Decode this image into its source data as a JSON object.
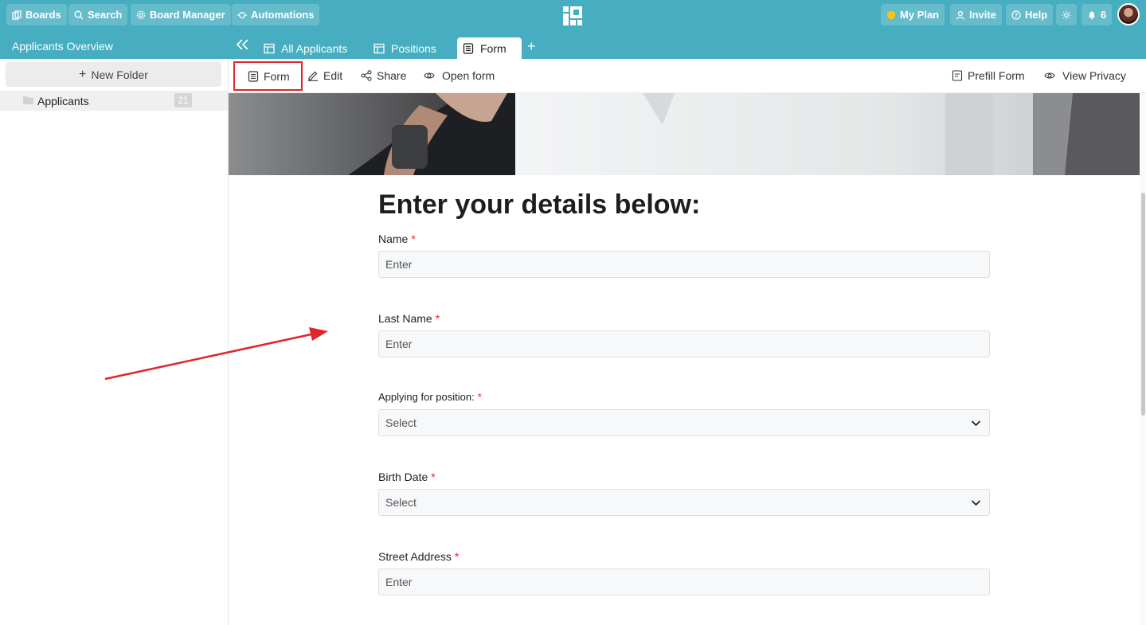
{
  "topnav": {
    "boards": "Boards",
    "search": "Search",
    "board_manager": "Board Manager",
    "automations": "Automations",
    "my_plan": "My Plan",
    "invite": "Invite",
    "help": "Help",
    "notifications_count": "6"
  },
  "workspace": {
    "title": "Applicants Overview"
  },
  "tabs": [
    {
      "label": "All Applicants",
      "icon": "table-icon"
    },
    {
      "label": "Positions",
      "icon": "table-icon"
    },
    {
      "label": "Form",
      "icon": "form-icon",
      "active": true
    }
  ],
  "add_tab": "+",
  "sidebar": {
    "new_folder": "New Folder",
    "new_folder_prefix": "+",
    "folders": [
      {
        "name": "Applicants",
        "count": "21"
      }
    ]
  },
  "toolbar": {
    "form": "Form",
    "edit": "Edit",
    "share": "Share",
    "open_form": "Open form",
    "prefill_form": "Prefill Form",
    "view_privacy": "View Privacy"
  },
  "form": {
    "title": "Enter your details below:",
    "required_mark": "*",
    "fields": [
      {
        "label": "Name",
        "placeholder": "Enter",
        "type": "text"
      },
      {
        "label": "Last Name",
        "placeholder": "Enter",
        "type": "text"
      },
      {
        "label": "Applying for position:",
        "placeholder": "Select",
        "type": "select"
      },
      {
        "label": "Birth Date",
        "placeholder": "Select",
        "type": "select"
      },
      {
        "label": "Street Address",
        "placeholder": "Enter",
        "type": "text"
      }
    ]
  },
  "colors": {
    "brand": "#46aec0",
    "highlight": "#e0252b",
    "required": "#e0252b",
    "plan_shield": "#f5c518"
  }
}
